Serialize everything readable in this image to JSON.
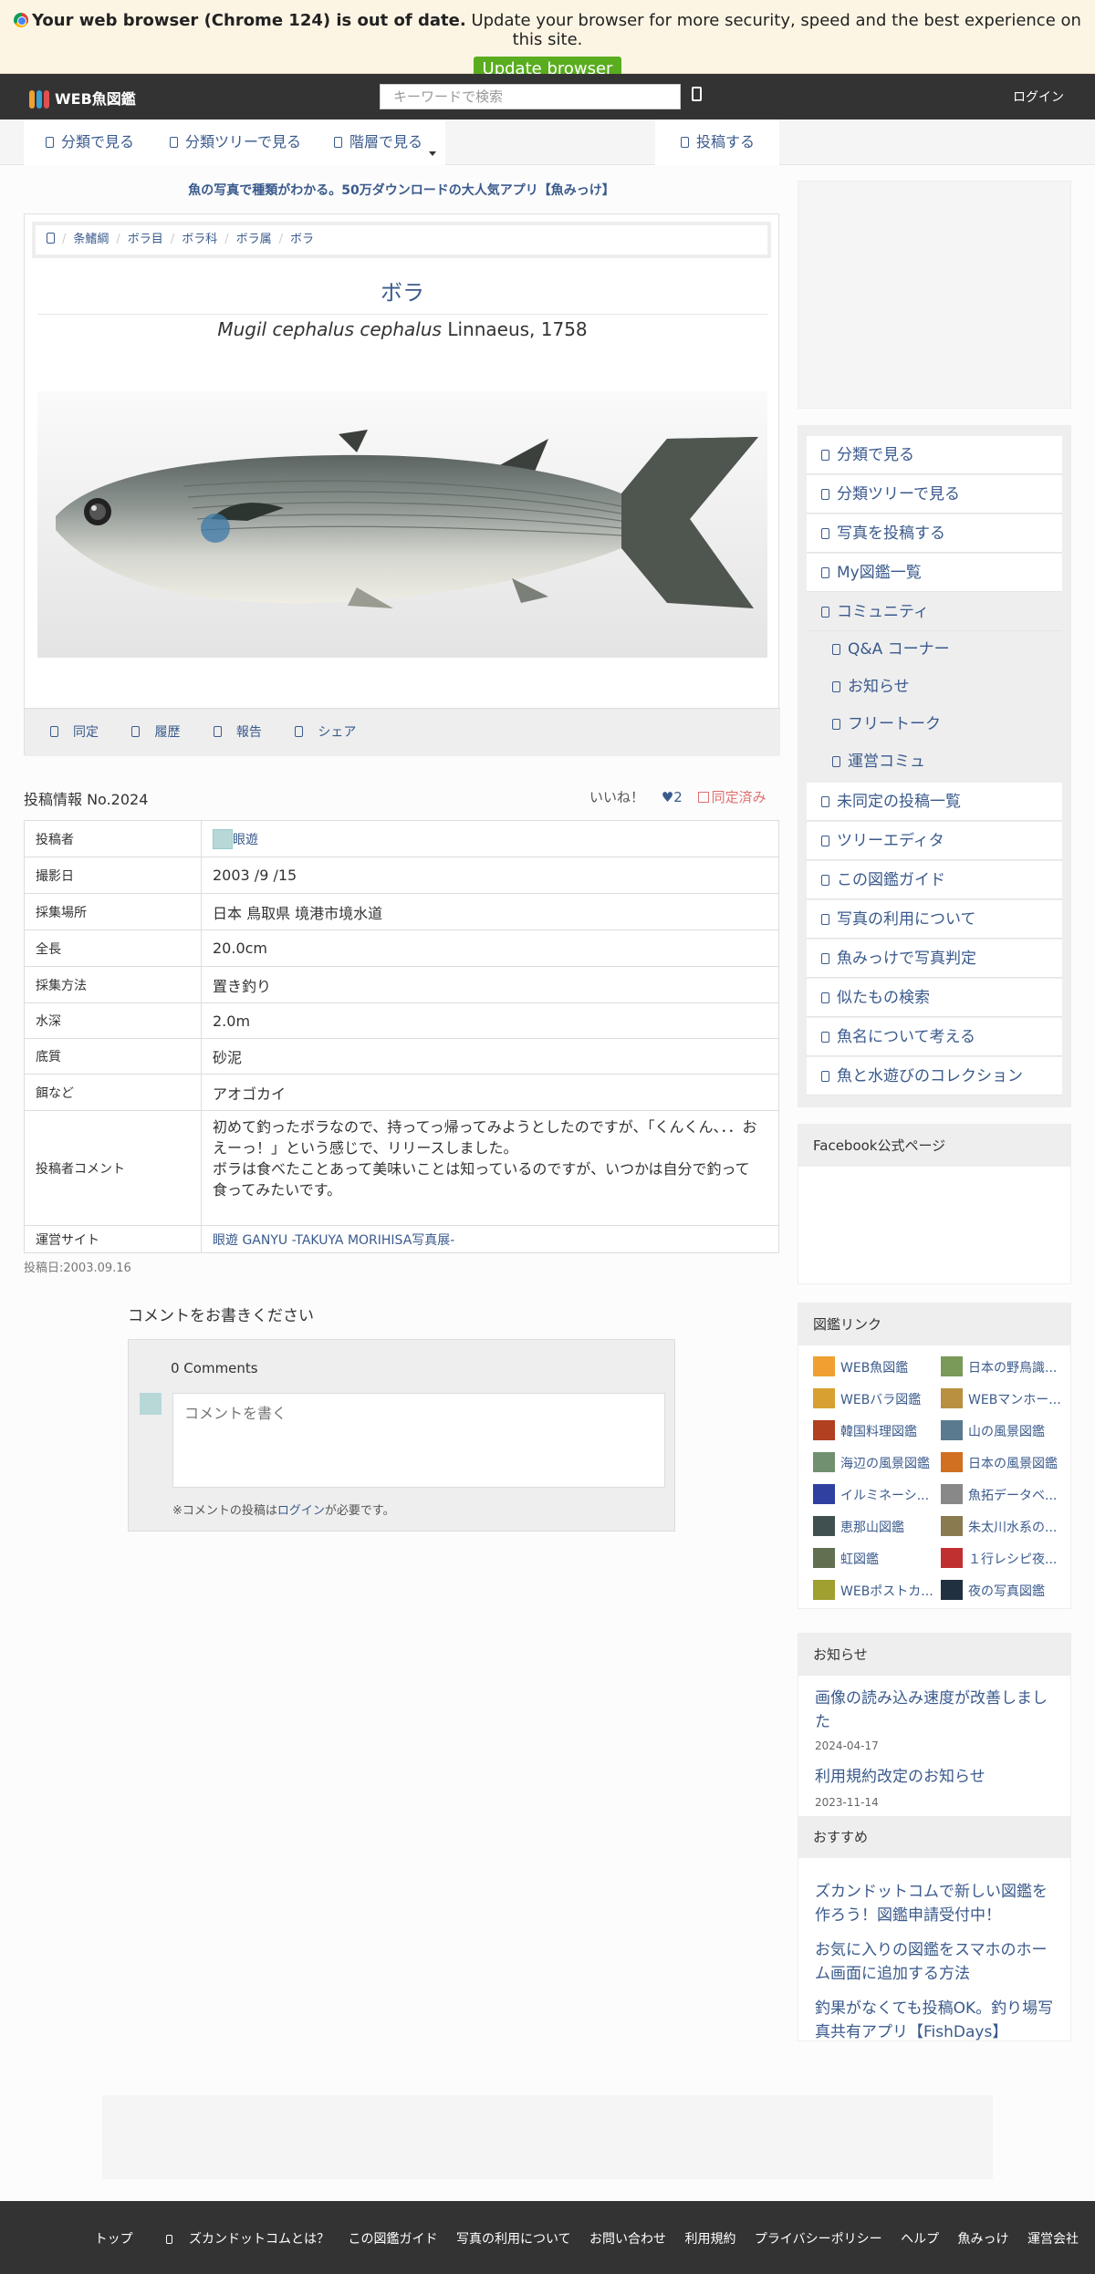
{
  "browser_warning": {
    "bold": "Your web browser (Chrome 124) is out of date.",
    "text": "Update your browser for more security, speed and the best experience on this site.",
    "button": "Update browser"
  },
  "topbar": {
    "logo": "WEB魚図鑑",
    "search_placeholder": "キーワードで検索",
    "login": "ログイン"
  },
  "subnav": {
    "items": [
      "分類で見る",
      "分類ツリーで見る",
      "階層で見る"
    ],
    "post": "投稿する"
  },
  "promo": "魚の写真で種類がわかる。50万ダウンロードの大人気アプリ【魚みっけ】",
  "breadcrumb": [
    "条鰭綱",
    "ボラ目",
    "ボラ科",
    "ボラ属",
    "ボラ"
  ],
  "species": {
    "title": "ボラ",
    "scientific": "Mugil cephalus cephalus",
    "author": "Linnaeus, 1758"
  },
  "actions": [
    "同定",
    "履歴",
    "報告",
    "シェア"
  ],
  "post": {
    "heading": "投稿情報 No.2024",
    "like": "いいね！",
    "like_count": "2",
    "identified": "同定済み",
    "rows": [
      {
        "k": "投稿者",
        "v": "眼遊"
      },
      {
        "k": "撮影日",
        "v": "2003 /9 /15"
      },
      {
        "k": "採集場所",
        "v": "日本 鳥取県 境港市境水道"
      },
      {
        "k": "全長",
        "v": "20.0cm"
      },
      {
        "k": "採集方法",
        "v": "置き釣り"
      },
      {
        "k": "水深",
        "v": "2.0m"
      },
      {
        "k": "底質",
        "v": "砂泥"
      },
      {
        "k": "餌など",
        "v": "アオゴカイ"
      },
      {
        "k": "投稿者コメント",
        "v": "初めて釣ったボラなので、持ってっ帰ってみようとしたのですが、「くんくん、．．おえーっ！」という感じで、リリースしました。\nボラは食べたことあって美味いことは知っているのですが、いつかは自分で釣って食ってみたいです。"
      },
      {
        "k": "運営サイト",
        "v": "眼遊 GANYU -TAKUYA MORIHISA写真展-"
      }
    ],
    "date": "投稿日:2003.09.16"
  },
  "comments": {
    "heading": "コメントをお書きください",
    "count": "0 Comments",
    "placeholder": "コメントを書く",
    "note_pre": "※コメントの投稿は",
    "note_link": "ログイン",
    "note_post": "が必要です。"
  },
  "side_menu": [
    "分類で見る",
    "分類ツリーで見る",
    "写真を投稿する",
    "My図鑑一覧",
    "コミュニティ",
    "Q&A コーナー",
    "お知らせ",
    "フリートーク",
    "運営コミュ",
    "未同定の投稿一覧",
    "ツリーエディタ",
    "この図鑑ガイド",
    "写真の利用について",
    "魚みっけで写真判定",
    "似たもの検索",
    "魚名について考える",
    "魚と水遊びのコレクション"
  ],
  "facebook": {
    "heading": "Facebook公式ページ"
  },
  "zukan_links": {
    "heading": "図鑑リンク",
    "items": [
      {
        "label": "WEB魚図鑑",
        "color": "#f0a030"
      },
      {
        "label": "日本の野鳥識...",
        "color": "#7a9a5a"
      },
      {
        "label": "WEBバラ図鑑",
        "color": "#d8a030"
      },
      {
        "label": "WEBマンホー...",
        "color": "#b89040"
      },
      {
        "label": "韓国料理図鑑",
        "color": "#b04020"
      },
      {
        "label": "山の風景図鑑",
        "color": "#5a7a90"
      },
      {
        "label": "海辺の風景図鑑",
        "color": "#709070"
      },
      {
        "label": "日本の風景図鑑",
        "color": "#d07020"
      },
      {
        "label": "イルミネーシ...",
        "color": "#3040a0"
      },
      {
        "label": "魚拓データベ...",
        "color": "#888888"
      },
      {
        "label": "恵那山図鑑",
        "color": "#405050"
      },
      {
        "label": "朱太川水系の...",
        "color": "#8a7a50"
      },
      {
        "label": "虹図鑑",
        "color": "#607050"
      },
      {
        "label": "１行レシピ夜...",
        "color": "#c03030"
      },
      {
        "label": "WEBポストカ...",
        "color": "#a0a030"
      },
      {
        "label": "夜の写真図鑑",
        "color": "#203040"
      }
    ]
  },
  "news": {
    "heading": "お知らせ",
    "items": [
      {
        "title": "画像の読み込み速度が改善しました",
        "date": "2024-04-17"
      },
      {
        "title": "利用規約改定のお知らせ",
        "date": "2023-11-14"
      }
    ]
  },
  "recommend": {
    "heading": "おすすめ",
    "items": [
      "ズカンドットコムで新しい図鑑を作ろう！図鑑申請受付中！",
      "お気に入りの図鑑をスマホのホーム画面に追加する方法",
      "釣果がなくても投稿OK。釣り場写真共有アプリ【FishDays】"
    ]
  },
  "footer": [
    "トップ",
    "ズカンドットコムとは？",
    "この図鑑ガイド",
    "写真の利用について",
    "お問い合わせ",
    "利用規約",
    "プライバシーポリシー",
    "ヘルプ",
    "魚みっけ",
    "運営会社"
  ]
}
